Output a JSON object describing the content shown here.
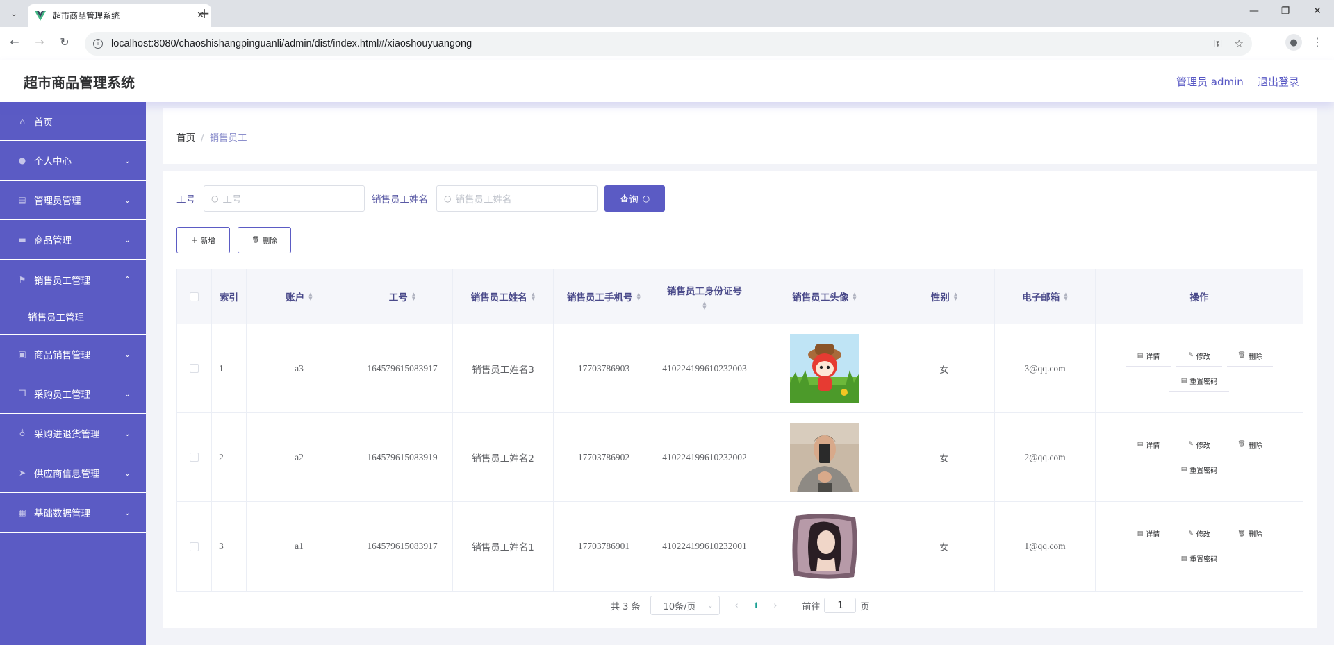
{
  "browser": {
    "tab_title": "超市商品管理系统",
    "url": "localhost:8080/chaoshishangpinguanli/admin/dist/index.html#/xiaoshouyuangong"
  },
  "header": {
    "title": "超市商品管理系统",
    "user": "管理员 admin",
    "logout": "退出登录"
  },
  "sidebar": {
    "items": [
      {
        "label": "首页",
        "icon": "home-icon"
      },
      {
        "label": "个人中心",
        "icon": "user-icon"
      },
      {
        "label": "管理员管理",
        "icon": "clipboard-icon"
      },
      {
        "label": "商品管理",
        "icon": "goods-icon"
      },
      {
        "label": "销售员工管理",
        "icon": "flag-icon"
      },
      {
        "label": "商品销售管理",
        "icon": "briefcase-icon"
      },
      {
        "label": "采购员工管理",
        "icon": "copy-icon"
      },
      {
        "label": "采购进退货管理",
        "icon": "microphone-icon"
      },
      {
        "label": "供应商信息管理",
        "icon": "send-icon"
      },
      {
        "label": "基础数据管理",
        "icon": "grid-icon"
      }
    ],
    "submenu": "销售员工管理"
  },
  "breadcrumb": {
    "home": "首页",
    "separator": "/",
    "current": "销售员工"
  },
  "search": {
    "label1": "工号",
    "placeholder1": "工号",
    "label2": "销售员工姓名",
    "placeholder2": "销售员工姓名",
    "query_button": "查询"
  },
  "actions": {
    "add": "新增",
    "delete": "删除"
  },
  "table": {
    "headers": [
      "索引",
      "账户",
      "工号",
      "销售员工姓名",
      "销售员工手机号",
      "销售员工身份证号",
      "销售员工头像",
      "性别",
      "电子邮箱",
      "操作"
    ],
    "rows": [
      {
        "index": "1",
        "account": "a3",
        "id": "164579615083917",
        "name": "销售员工姓名3",
        "phone": "17703786903",
        "idcard": "410224199610232003",
        "gender": "女",
        "email": "3@qq.com"
      },
      {
        "index": "2",
        "account": "a2",
        "id": "164579615083919",
        "name": "销售员工姓名2",
        "phone": "17703786902",
        "idcard": "410224199610232002",
        "gender": "女",
        "email": "2@qq.com"
      },
      {
        "index": "3",
        "account": "a1",
        "id": "164579615083917",
        "name": "销售员工姓名1",
        "phone": "17703786901",
        "idcard": "410224199610232001",
        "gender": "女",
        "email": "1@qq.com"
      }
    ],
    "op_labels": {
      "detail": "详情",
      "edit": "修改",
      "delete": "删除",
      "reset": "重置密码"
    }
  },
  "pagination": {
    "total": "共 3 条",
    "page_size": "10条/页",
    "current_page": "1",
    "goto_label": "前往",
    "goto_value": "1",
    "page_suffix": "页"
  },
  "colors": {
    "accent": "#5b5bc4",
    "page_active": "#1aa094"
  }
}
